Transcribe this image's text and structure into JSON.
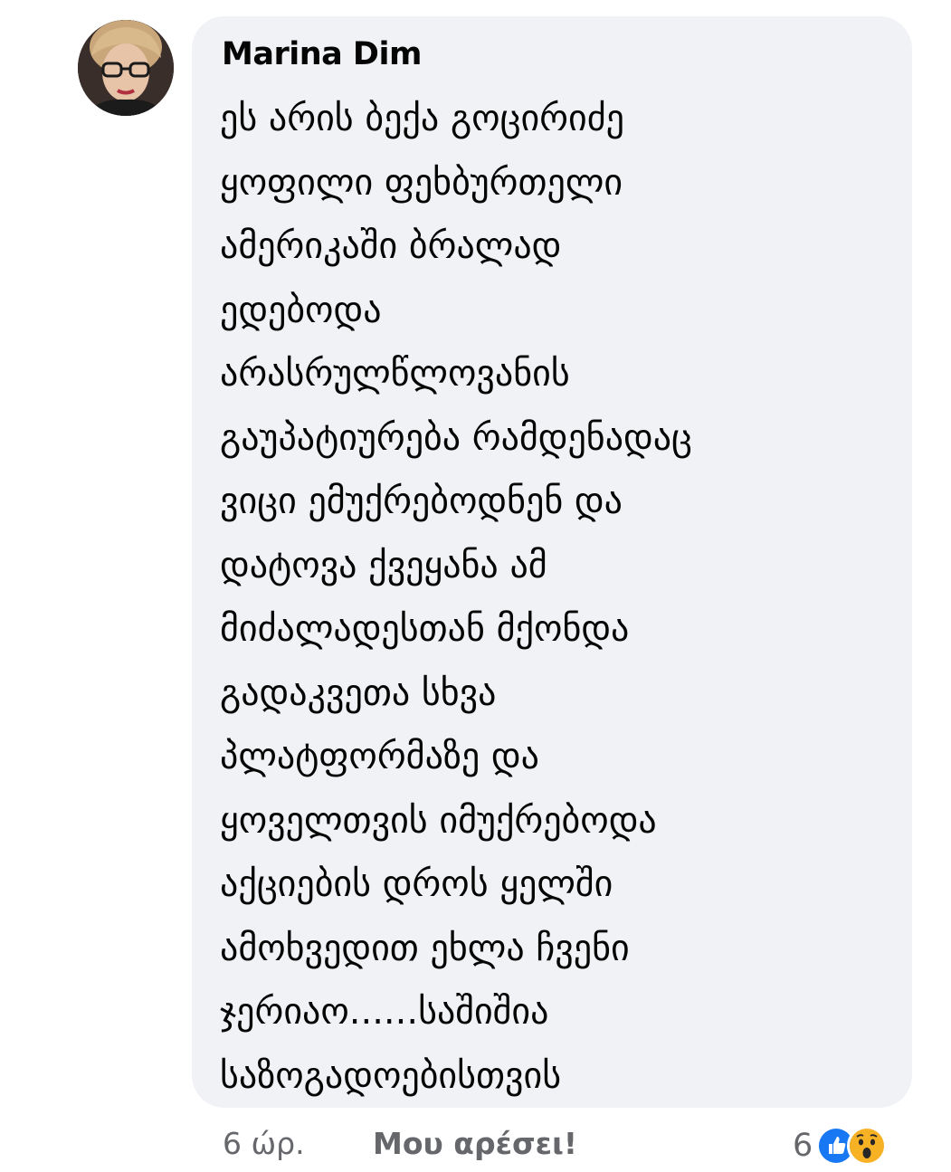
{
  "comment": {
    "author": "Marina Dim",
    "text": "ეს არის ბექა გოცირიძე\nყოფილი ფეხბურთელი\nამერიკაში ბრალად\nედებოდა\nარასრულწლოვანის\nგაუპატიურება რამდენადაც\nვიცი ემუქრებოდნენ და\nდატოვა ქვეყანა ამ\nმიძალადესთან მქონდა\nგადაკვეთა სხვა\nპლატფორმაზე და\nყოველთვის იმუქრებოდა\nაქციების დროს ყელში\nამოხვედით ეხლა ჩვენი\nჯერიაო......საშიშია\nსაზოგადოებისთვის",
    "time": "6 ώρ.",
    "like_label": "Μου αρέσει!",
    "reaction_count": "6",
    "reaction_icons": [
      "like-icon",
      "wow-icon"
    ]
  },
  "colors": {
    "bubble": "#f0f2f5",
    "secondary_text": "#65676b",
    "like_blue": "#1877f2",
    "wow_yellow": "#f7b125"
  }
}
